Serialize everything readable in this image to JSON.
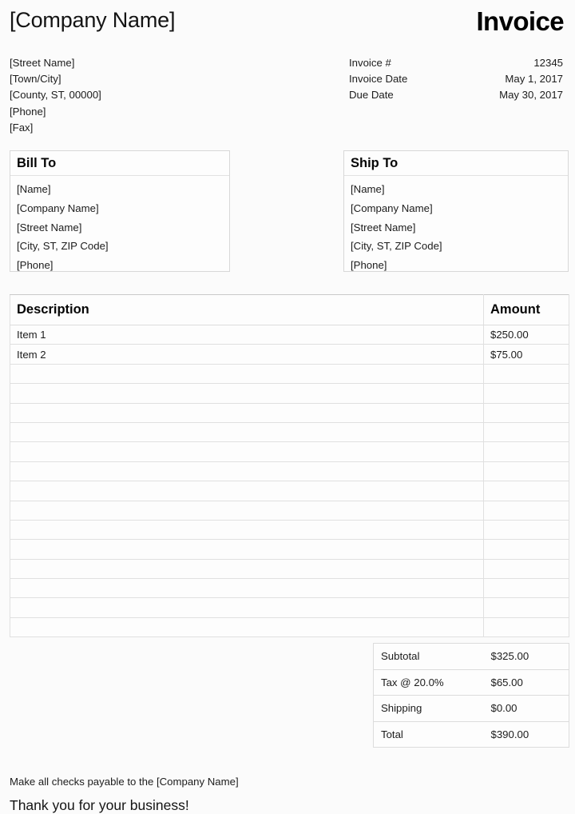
{
  "header": {
    "company_name": "[Company Name]",
    "document_title": "Invoice"
  },
  "sender": {
    "lines": [
      "[Street Name]",
      "[Town/City]",
      "[County, ST, 00000]",
      "[Phone]",
      "[Fax]"
    ]
  },
  "invoice_meta": {
    "rows": [
      {
        "label": "Invoice #",
        "value": "12345"
      },
      {
        "label": "Invoice Date",
        "value": "May 1, 2017"
      },
      {
        "label": "Due Date",
        "value": "May 30, 2017"
      }
    ]
  },
  "bill_to": {
    "title": "Bill To",
    "lines": [
      "[Name]",
      "[Company Name]",
      "[Street Name]",
      "[City, ST, ZIP Code]",
      "[Phone]"
    ]
  },
  "ship_to": {
    "title": "Ship To",
    "lines": [
      "[Name]",
      "[Company Name]",
      "[Street Name]",
      "[City, ST, ZIP Code]",
      "[Phone]"
    ]
  },
  "items_table": {
    "columns": [
      "Description",
      "Amount"
    ],
    "rows": [
      {
        "description": "Item 1",
        "amount": "$250.00"
      },
      {
        "description": "Item 2",
        "amount": "$75.00"
      },
      {
        "description": "",
        "amount": ""
      },
      {
        "description": "",
        "amount": ""
      },
      {
        "description": "",
        "amount": ""
      },
      {
        "description": "",
        "amount": ""
      },
      {
        "description": "",
        "amount": ""
      },
      {
        "description": "",
        "amount": ""
      },
      {
        "description": "",
        "amount": ""
      },
      {
        "description": "",
        "amount": ""
      },
      {
        "description": "",
        "amount": ""
      },
      {
        "description": "",
        "amount": ""
      },
      {
        "description": "",
        "amount": ""
      },
      {
        "description": "",
        "amount": ""
      },
      {
        "description": "",
        "amount": ""
      },
      {
        "description": "",
        "amount": ""
      }
    ]
  },
  "totals": {
    "rows": [
      {
        "label": "Subtotal",
        "value": "$325.00"
      },
      {
        "label": "Tax @ 20.0%",
        "value": "$65.00"
      },
      {
        "label": "Shipping",
        "value": "$0.00"
      },
      {
        "label": "Total",
        "value": "$390.00"
      }
    ]
  },
  "footer": {
    "payable_note": "Make all checks payable to the [Company Name]",
    "thanks": "Thank you for your business!"
  },
  "colors": {
    "page_background": "#fbfbfb",
    "text": "#1c1c1c",
    "heading": "#050505",
    "border": "#e0e0e0",
    "box_border": "#d8d8d8"
  }
}
